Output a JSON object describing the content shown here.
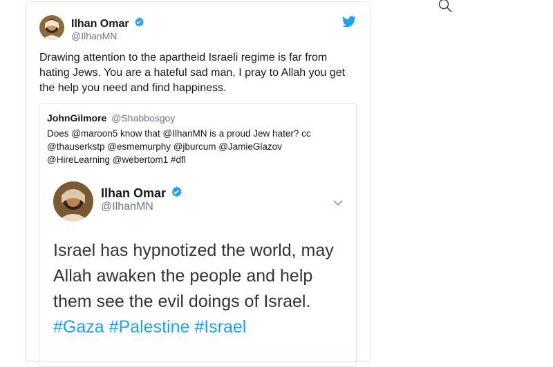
{
  "tweet": {
    "author_name": "Ilhan Omar",
    "author_handle": "@IlhanMN",
    "text": "Drawing attention to the apartheid Israeli regime is far from hating Jews. You are a hateful sad man, I pray to Allah you get the help you need and find happiness."
  },
  "quote": {
    "author_name": "JohnGilmore",
    "author_handle": "@Shabbosgoy",
    "text": "Does @maroon5 know that @IlhanMN is a proud Jew hater? cc @thauserkstp @esmemurphy @jburcum @JamieGlazov @HireLearning @webertom1 #dfl"
  },
  "embedded": {
    "author_name": "Ilhan Omar",
    "author_handle": "@IlhanMN",
    "text_plain": "Israel has hypnotized the world, may Allah awaken the people and help them see the evil doings of Israel.",
    "hashtag_1": "#Gaza",
    "hashtag_2": "#Palestine",
    "hashtag_3": "#Israel"
  },
  "icons": {
    "brand": "twitter-bird-icon",
    "search": "search-icon",
    "verified": "verified-badge-icon",
    "chevron": "chevron-down-icon"
  },
  "colors": {
    "accent": "#1da1f2",
    "muted": "#657786",
    "border": "#e1e8ed"
  }
}
